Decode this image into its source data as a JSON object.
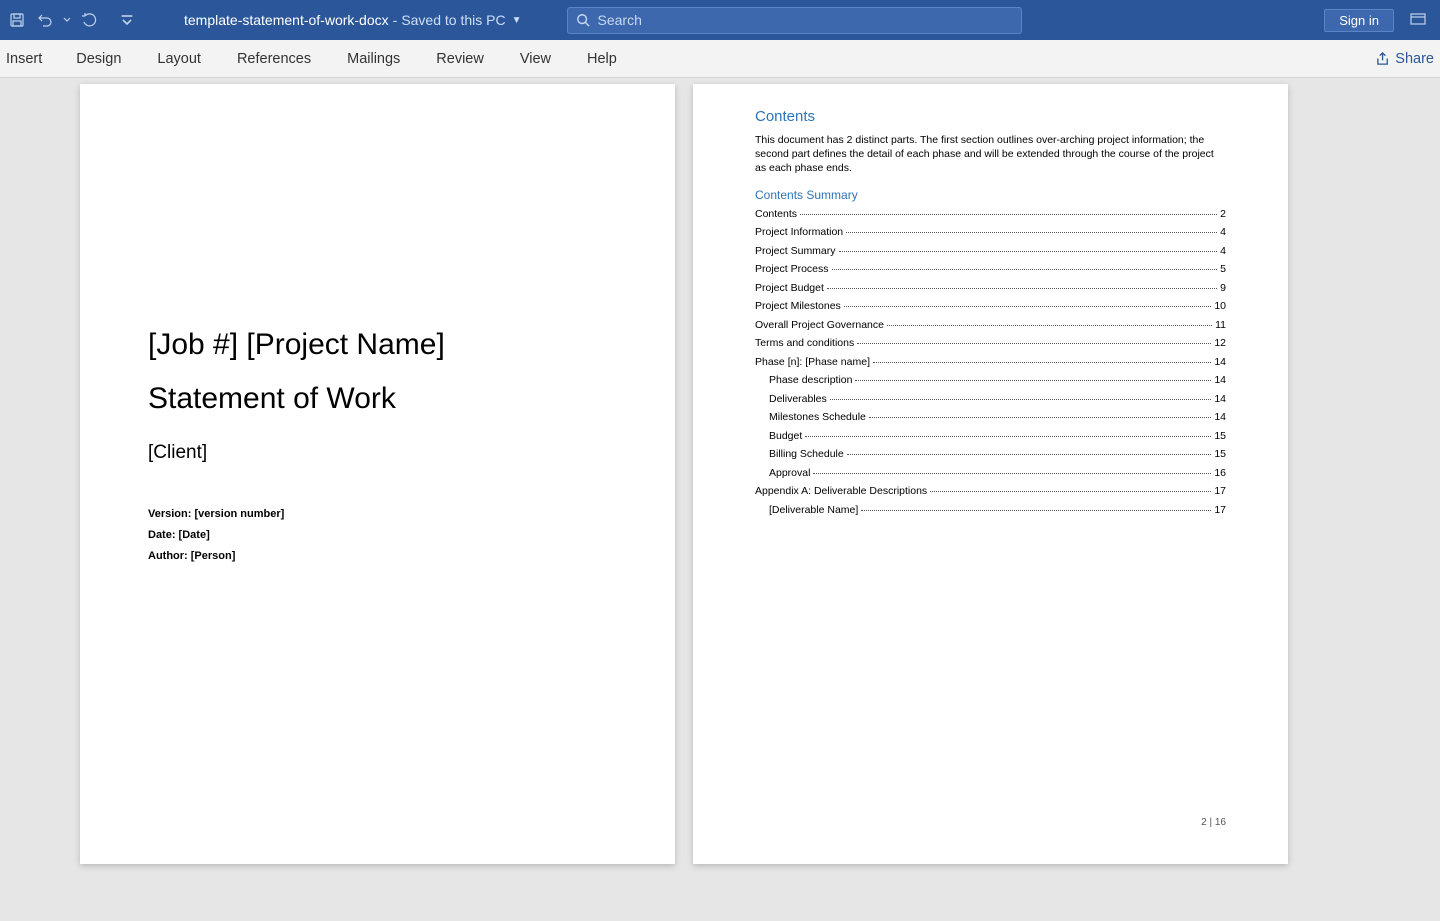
{
  "titlebar": {
    "filename": "template-statement-of-work-docx",
    "save_status": "Saved to this PC",
    "search_placeholder": "Search",
    "sign_in": "Sign in"
  },
  "ribbon": {
    "tabs": [
      "Insert",
      "Design",
      "Layout",
      "References",
      "Mailings",
      "Review",
      "View",
      "Help"
    ],
    "share": "Share"
  },
  "page1": {
    "title1": "[Job #] [Project Name]",
    "title2": "Statement of Work",
    "client": "[Client]",
    "version": "Version: [version number]",
    "date": "Date: [Date]",
    "author": "Author: [Person]"
  },
  "page2": {
    "contents_heading": "Contents",
    "description": "This document has 2 distinct parts. The first section outlines over-arching project information; the second part defines the detail of each phase and will be extended through the course of the project as each phase ends.",
    "summary_heading": "Contents Summary",
    "toc": [
      {
        "label": "Contents",
        "page": "2",
        "sub": false
      },
      {
        "label": "Project Information",
        "page": "4",
        "sub": false
      },
      {
        "label": "Project Summary",
        "page": "4",
        "sub": false
      },
      {
        "label": "Project Process",
        "page": "5",
        "sub": false
      },
      {
        "label": "Project Budget",
        "page": "9",
        "sub": false
      },
      {
        "label": "Project Milestones",
        "page": "10",
        "sub": false
      },
      {
        "label": "Overall Project Governance",
        "page": "11",
        "sub": false
      },
      {
        "label": "Terms and conditions",
        "page": "12",
        "sub": false
      },
      {
        "label": "Phase [n]:  [Phase name]",
        "page": "14",
        "sub": false
      },
      {
        "label": "Phase description",
        "page": "14",
        "sub": true
      },
      {
        "label": "Deliverables",
        "page": "14",
        "sub": true
      },
      {
        "label": "Milestones Schedule",
        "page": "14",
        "sub": true
      },
      {
        "label": "Budget",
        "page": "15",
        "sub": true
      },
      {
        "label": "Billing Schedule",
        "page": "15",
        "sub": true
      },
      {
        "label": "Approval",
        "page": "16",
        "sub": true
      },
      {
        "label": "Appendix A: Deliverable Descriptions",
        "page": "17",
        "sub": false
      },
      {
        "label": "[Deliverable Name]",
        "page": "17",
        "sub": true
      }
    ],
    "footer": "2 | 16"
  }
}
